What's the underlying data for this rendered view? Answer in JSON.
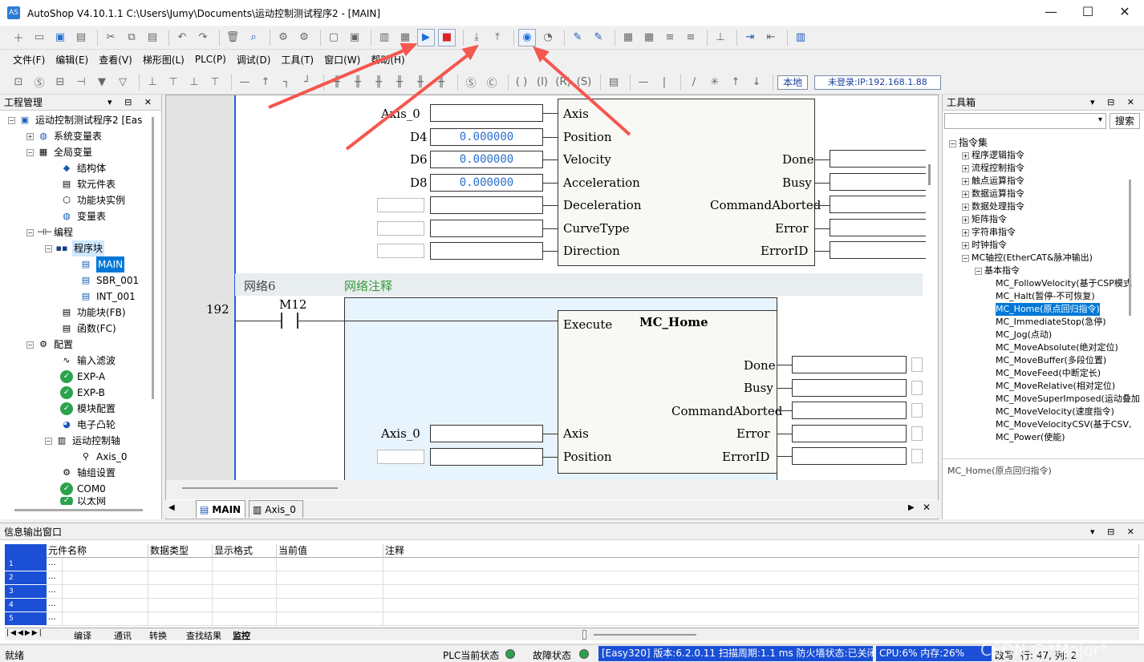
{
  "window": {
    "title": "AutoShop V4.10.1.1  C:\\Users\\Jumy\\Documents\\运动控制测试程序2 - [MAIN]",
    "minimize": "—",
    "maximize": "☐",
    "close": "✕"
  },
  "menu": [
    "文件(F)",
    "编辑(E)",
    "查看(V)",
    "梯形图(L)",
    "PLC(P)",
    "调试(D)",
    "工具(T)",
    "窗口(W)",
    "帮助(H)"
  ],
  "toolbar3": {
    "local": "本地",
    "login": "未登录:IP:192.168.1.88"
  },
  "project": {
    "title": "工程管理",
    "items": [
      {
        "label": "运动控制测试程序2 [Eas"
      },
      {
        "label": "系统变量表"
      },
      {
        "label": "全局变量"
      },
      {
        "label": "结构体"
      },
      {
        "label": "软元件表"
      },
      {
        "label": "功能块实例"
      },
      {
        "label": "变量表"
      },
      {
        "label": "编程"
      },
      {
        "label": "程序块"
      },
      {
        "label": "MAIN"
      },
      {
        "label": "SBR_001"
      },
      {
        "label": "INT_001"
      },
      {
        "label": "功能块(FB)"
      },
      {
        "label": "函数(FC)"
      },
      {
        "label": "配置"
      },
      {
        "label": "输入滤波"
      },
      {
        "label": "EXP-A"
      },
      {
        "label": "EXP-B"
      },
      {
        "label": "模块配置"
      },
      {
        "label": "电子凸轮"
      },
      {
        "label": "运动控制轴"
      },
      {
        "label": "Axis_0"
      },
      {
        "label": "轴组设置"
      },
      {
        "label": "COM0"
      },
      {
        "label": "以太网"
      }
    ]
  },
  "editor": {
    "fb1": {
      "in_labels": [
        "Axis",
        "Position",
        "Velocity",
        "Acceleration",
        "Deceleration",
        "CurveType",
        "Direction"
      ],
      "out_labels": [
        "Done",
        "Busy",
        "CommandAborted",
        "Error",
        "ErrorID"
      ],
      "in_vars": [
        "Axis_0",
        "D4",
        "D6",
        "D8"
      ],
      "values": [
        "0.000000",
        "0.000000",
        "0.000000"
      ]
    },
    "network": {
      "label": "网络6",
      "comment": "网络注释",
      "line": "192",
      "contact": "M12"
    },
    "fb2": {
      "name": "MC_Home",
      "execute": "Execute",
      "out_labels": [
        "Done",
        "Busy",
        "CommandAborted",
        "Error",
        "ErrorID"
      ],
      "in_labels": [
        "Axis",
        "Position"
      ],
      "axis_var": "Axis_0"
    }
  },
  "tabs": [
    {
      "label": "MAIN"
    },
    {
      "label": "Axis_0"
    }
  ],
  "toolbox": {
    "title": "工具箱",
    "search": "搜索",
    "root": "指令集",
    "items": [
      "程序逻辑指令",
      "流程控制指令",
      "触点运算指令",
      "数据运算指令",
      "数据处理指令",
      "矩阵指令",
      "字符串指令",
      "时钟指令",
      "MC轴控(EtherCAT&脉冲输出)"
    ],
    "basic": "基本指令",
    "mc": [
      "MC_FollowVelocity(基于CSP模式",
      "MC_Halt(暂停-不可恢复)",
      "MC_Home(原点回归指令)",
      "MC_ImmediateStop(急停)",
      "MC_Jog(点动)",
      "MC_MoveAbsolute(绝对定位)",
      "MC_MoveBuffer(多段位置)",
      "MC_MoveFeed(中断定长)",
      "MC_MoveRelative(相对定位)",
      "MC_MoveSuperImposed(运动叠加",
      "MC_MoveVelocity(速度指令)",
      "MC_MoveVelocityCSV(基于CSV,",
      "MC_Power(使能)"
    ],
    "desc": "MC_Home(原点回归指令)"
  },
  "output": {
    "title": "信息输出窗口",
    "headers": [
      "元件名称",
      "数据类型",
      "显示格式",
      "当前值",
      "注释"
    ],
    "rows": [
      "1",
      "2",
      "3",
      "4",
      "5"
    ],
    "cell": "...",
    "tabs": [
      "编译",
      "通讯",
      "转换",
      "查找结果",
      "监控"
    ]
  },
  "status": {
    "ready": "就绪",
    "plc": "PLC当前状态",
    "fault": "故障状态",
    "info": "[Easy320] 版本:6.2.0.11 扫描周期:1.1 ms 防火墙状态:已关闭",
    "cpu": "CPU:6%  内存:26%",
    "mode": "改写",
    "pos": "行:  47, 列:  2",
    "watermark": "CSDN @*Major*"
  },
  "colors": {
    "accent": "#0078d7",
    "arrow": "#f4574f",
    "status_ok": "#2ba24c",
    "value_blue": "#2a6fd0"
  }
}
